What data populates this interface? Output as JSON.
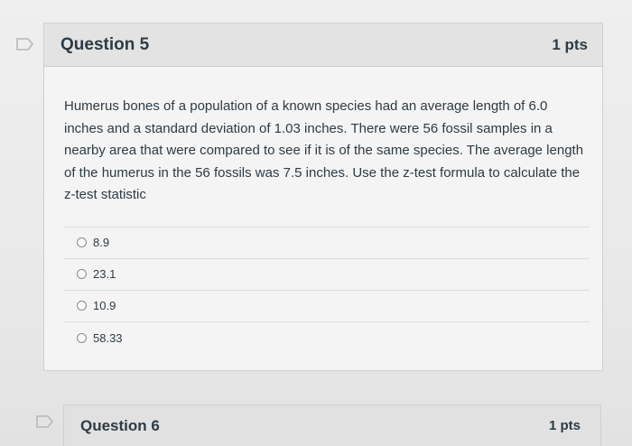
{
  "question5": {
    "title": "Question 5",
    "points": "1 pts",
    "flag_icon": "bookmark-flag-icon",
    "text": "Humerus bones of a population of a known species had an average length of 6.0 inches and a standard deviation of 1.03 inches. There were 56 fossil samples in a nearby area that were compared to see if it is of the same species. The average length of the humerus in the 56 fossils was 7.5 inches. Use the z-test formula to calculate the z-test statistic",
    "answers": [
      {
        "label": "8.9"
      },
      {
        "label": "23.1"
      },
      {
        "label": "10.9"
      },
      {
        "label": "58.33"
      }
    ]
  },
  "question6": {
    "title": "Question 6",
    "points": "1 pts",
    "flag_icon": "bookmark-flag-icon"
  },
  "colors": {
    "text": "#2d3b45",
    "header_bg": "#e3e3e3",
    "border": "#cfcfcf"
  }
}
